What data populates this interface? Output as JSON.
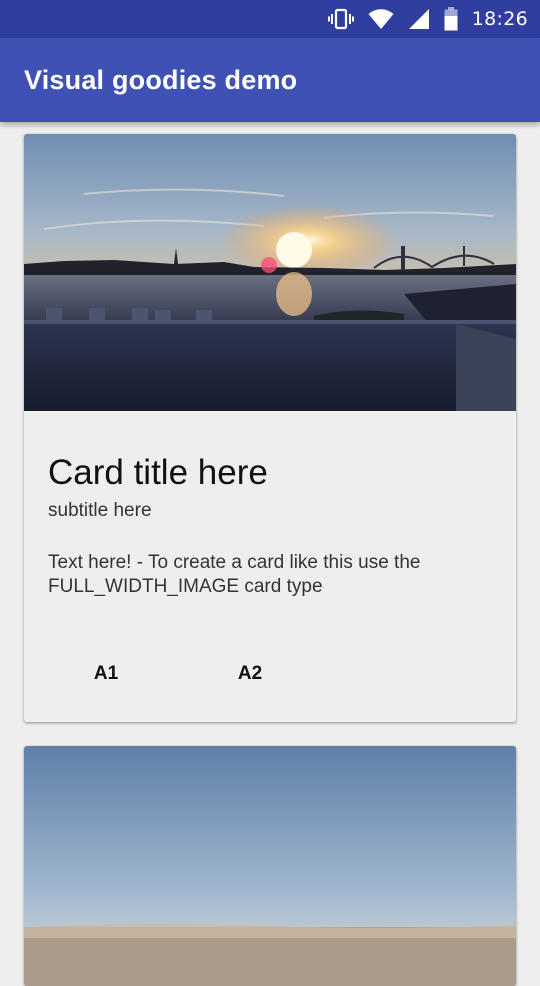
{
  "status_bar": {
    "time": "18:26",
    "icons": [
      "vibrate-icon",
      "wifi-icon",
      "signal-icon",
      "battery-icon"
    ]
  },
  "app_bar": {
    "title": "Visual goodies demo"
  },
  "cards": [
    {
      "image": "sunset-river-bridge-photo",
      "title": "Card title here",
      "subtitle": "subtitle here",
      "text": "Text here! - To create a card like this use the FULL_WIDTH_IMAGE card type",
      "actions": [
        "A1",
        "A2"
      ]
    },
    {
      "image": "sky-photo"
    }
  ],
  "colors": {
    "status_bar": "#303f9f",
    "app_bar": "#3f51b5",
    "background": "#eeeeee"
  }
}
